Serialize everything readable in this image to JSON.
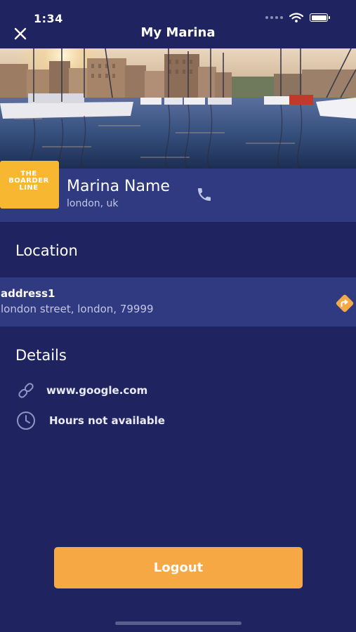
{
  "status_bar": {
    "time": "1:34"
  },
  "nav": {
    "title": "My Marina"
  },
  "marina": {
    "logo_text": "THE BOARDER LINE",
    "name": "Marina Name",
    "location": "london, uk"
  },
  "location_section": {
    "title": "Location",
    "address_name": "address1",
    "address_line": "london street, london, 79999"
  },
  "details_section": {
    "title": "Details",
    "website": "www.google.com",
    "hours": "Hours not available"
  },
  "logout": {
    "label": "Logout"
  },
  "colors": {
    "background": "#1f2461",
    "row_background": "#2f3a80",
    "accent": "#f5a843",
    "logo_yellow": "#f7b731"
  }
}
